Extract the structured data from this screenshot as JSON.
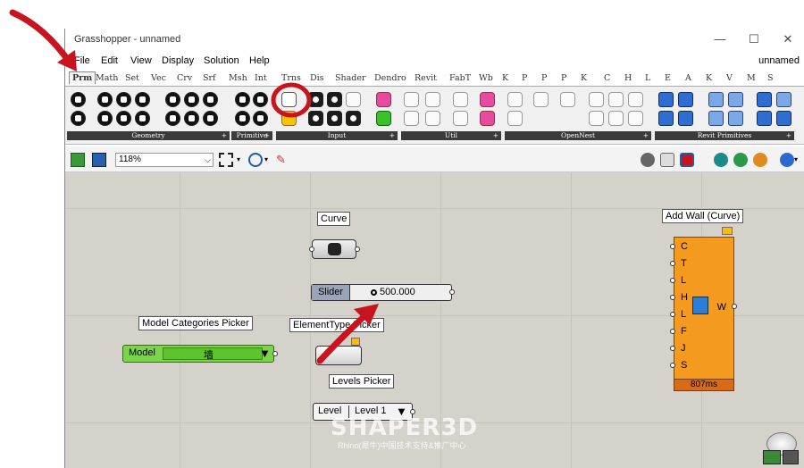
{
  "window": {
    "title": "Grasshopper - unnamed",
    "doc_name": "unnamed",
    "controls": [
      "—",
      "☐",
      "✕"
    ]
  },
  "menu": [
    "File",
    "Edit",
    "View",
    "Display",
    "Solution",
    "Help"
  ],
  "tabs": [
    "Prm",
    "Math",
    "Set",
    "Vec",
    "Crv",
    "Srf",
    "Msh",
    "Int",
    "Trns",
    "Dis",
    "Shader",
    "Dendro",
    "Revit",
    "FabT",
    "Wb",
    "K",
    "P",
    "P",
    "P",
    "K",
    "C",
    "H",
    "L",
    "E",
    "A",
    "K",
    "V",
    "M",
    "S"
  ],
  "active_tab": "Prm",
  "ribbon_panels": [
    "Geometry",
    "Primitive",
    "Input",
    "Util",
    "OpenNest",
    "Revit Primitives"
  ],
  "toolbar": {
    "zoom": "118%"
  },
  "canvas": {
    "curve": {
      "label": "Curve"
    },
    "slider": {
      "label": "Slider",
      "value": "500.000"
    },
    "model_picker": {
      "title": "Model Categories Picker",
      "label": "Model",
      "value": "墙"
    },
    "elementtype_picker": {
      "title": "ElementType Picker"
    },
    "levels_picker": {
      "title": "Levels Picker",
      "label": "Level",
      "value": "Level 1"
    },
    "add_wall": {
      "title": "Add Wall (Curve)",
      "inputs": [
        "C",
        "T",
        "L",
        "H",
        "L",
        "F",
        "J",
        "S"
      ],
      "output": "W",
      "time": "807ms"
    }
  },
  "watermark": {
    "logo": "SHAPER3D",
    "subtitle": "Rhino(犀牛)中国技术支持&推广中心"
  },
  "colors": {
    "accent_red": "#c8141e",
    "wall_orange": "#f39a1f",
    "model_green": "#7bd44a"
  }
}
